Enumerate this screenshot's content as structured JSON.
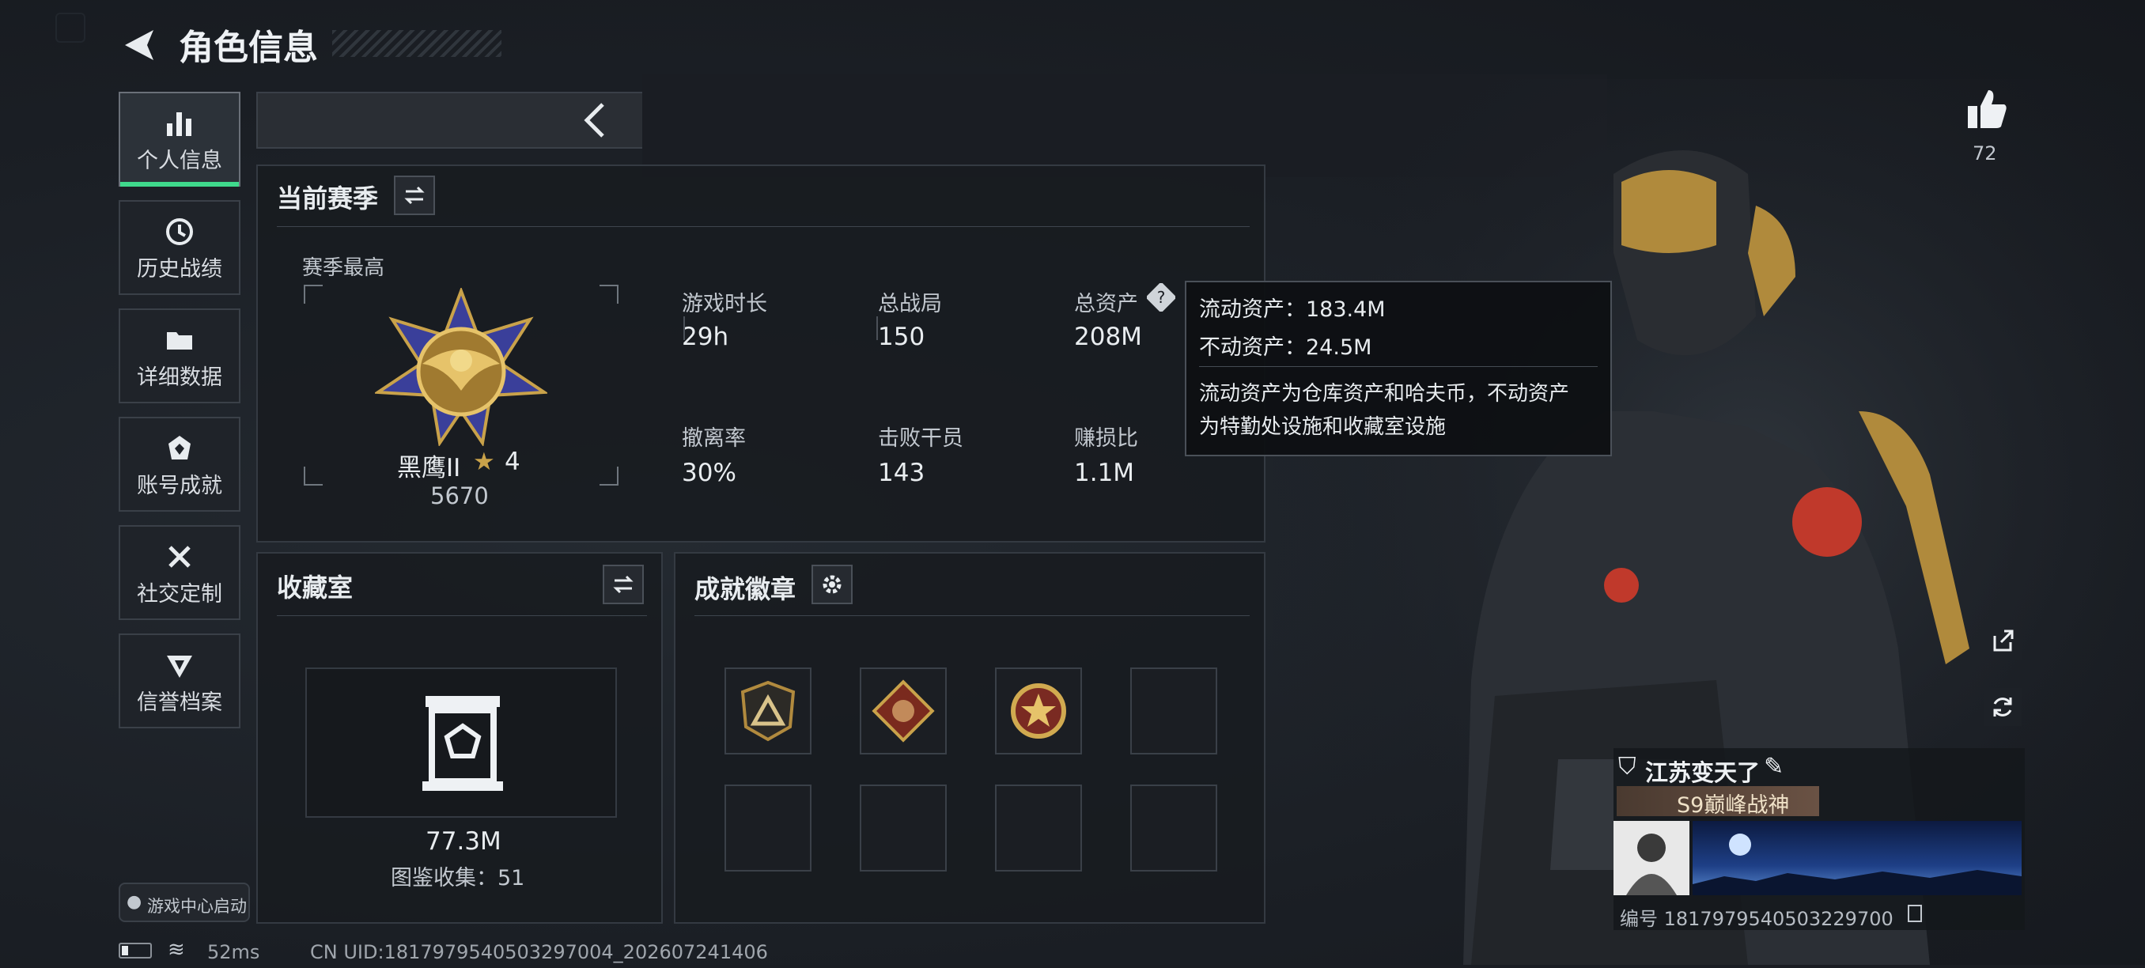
{
  "header": {
    "title": "角色信息",
    "back_icon": "arrow-left-icon"
  },
  "sidebar": {
    "items": [
      {
        "label": "个人信息",
        "icon": "bar-chart-icon",
        "active": true
      },
      {
        "label": "历史战绩",
        "icon": "history-icon",
        "active": false
      },
      {
        "label": "详细数据",
        "icon": "folder-icon",
        "active": false
      },
      {
        "label": "账号成就",
        "icon": "achievement-icon",
        "active": false
      },
      {
        "label": "社交定制",
        "icon": "tools-icon",
        "active": false
      },
      {
        "label": "信誉档案",
        "icon": "shield-icon",
        "active": false
      }
    ],
    "game_center": "游戏中心启动"
  },
  "season": {
    "title": "当前赛季",
    "best_label": "赛季最高",
    "rank_name": "黑鹰II",
    "rank_stars": "4",
    "rank_score": "5670",
    "stats": [
      {
        "label": "游戏时长",
        "value": "29h"
      },
      {
        "label": "总战局",
        "value": "150"
      },
      {
        "label": "总资产",
        "value": "208M"
      },
      {
        "label": "撤离率",
        "value": "30%"
      },
      {
        "label": "击败干员",
        "value": "143"
      },
      {
        "label": "赚损比",
        "value": "1.1M"
      }
    ]
  },
  "tooltip": {
    "line1": "流动资产：183.4M",
    "line2": "不动资产：24.5M",
    "desc1": "流动资产为仓库资产和哈夫币，不动资产",
    "desc2": "为特勤处设施和收藏室设施"
  },
  "collection": {
    "title": "收藏室",
    "value": "77.3M",
    "count": "图鉴收集：51"
  },
  "badges": {
    "title": "成就徽章"
  },
  "likes": {
    "count": "72"
  },
  "player": {
    "name": "江苏变天了",
    "title_badge": "S9巅峰战神",
    "id_text": "编号 1817979540503229700"
  },
  "status": {
    "ping": "52ms",
    "uid": "CN UID:1817979540503297004_202607241406"
  },
  "colors": {
    "accent": "#3fd98c",
    "gold": "#c9a24a"
  }
}
